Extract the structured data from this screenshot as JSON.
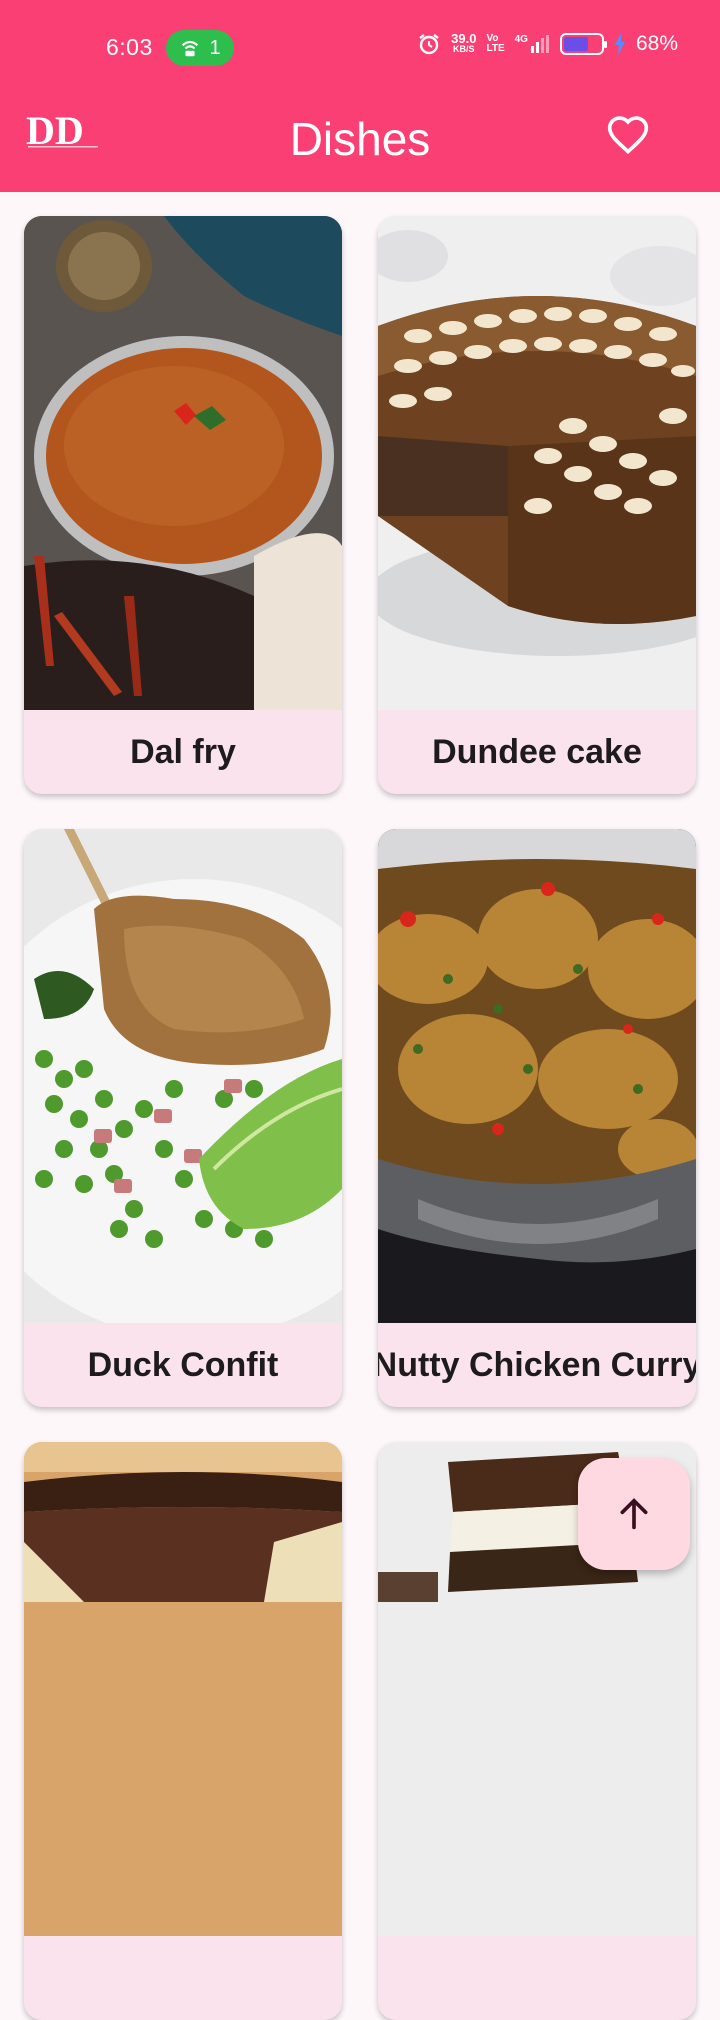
{
  "status_bar": {
    "time": "6:03",
    "hotspot_count": "1",
    "net_speed_value": "39.0",
    "net_speed_unit": "KB/S",
    "volte_top": "Vo",
    "volte_bottom": "LTE",
    "network_type": "4G",
    "battery_level": 0.68,
    "battery_percent": "68%",
    "icons": [
      "hotspot-icon",
      "alarm-icon",
      "signal-icon",
      "battery-icon",
      "charging-icon"
    ]
  },
  "app_bar": {
    "logo_text": "DD",
    "title": "Dishes",
    "favorites_icon": "heart-outline-icon"
  },
  "dishes": [
    {
      "name": "Dal fry"
    },
    {
      "name": "Dundee cake"
    },
    {
      "name": "Duck Confit"
    },
    {
      "name": "Nutty Chicken Curry"
    },
    {
      "name": ""
    },
    {
      "name": ""
    }
  ],
  "fab": {
    "icon": "arrow-up-icon"
  },
  "colors": {
    "primary": "#FA3F74",
    "card_label_bg": "#FAE3EC",
    "fab_bg": "#FFD9E2",
    "background": "#FDF7FA"
  }
}
